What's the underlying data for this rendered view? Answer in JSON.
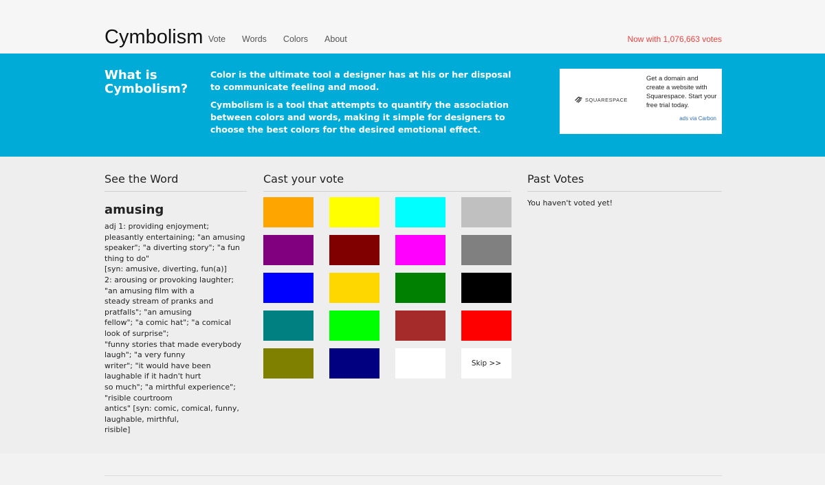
{
  "header": {
    "logo": "Cymbolism",
    "nav": [
      "Vote",
      "Words",
      "Colors",
      "About"
    ],
    "votes_text": "Now with 1,076,663 votes"
  },
  "hero": {
    "title": "What is Cymbolism?",
    "paragraph1": "Color is the ultimate tool a designer has at his or her disposal to communicate feeling and mood.",
    "paragraph2": "Cymbolism is a tool that attempts to quantify the association between colors and words, making it simple for designers to choose the best colors for the desired emotional effect."
  },
  "ad": {
    "brand": "SQUARESPACE",
    "text": "Get a domain and create a website with Squarespace. Start your free trial today.",
    "via": "ads via Carbon"
  },
  "word_section": {
    "heading": "See the Word",
    "word": "amusing",
    "definition": "adj 1: providing enjoyment; pleasantly entertaining; \"an amusing\nspeaker\"; \"a diverting story\"; \"a fun thing to do\"\n[syn: amusive, diverting, fun(a)]\n2: arousing or provoking laughter; \"an amusing film with a\nsteady stream of pranks and pratfalls\"; \"an amusing\nfellow\"; \"a comic hat\"; \"a comical look of surprise\";\n\"funny stories that made everybody laugh\"; \"a very funny\nwriter\"; \"it would have been laughable if it hadn't hurt\nso much\"; \"a mirthful experience\"; \"risible courtroom\nantics\" [syn: comic, comical, funny, laughable, mirthful,\nrisible]"
  },
  "vote_section": {
    "heading": "Cast your vote",
    "colors": [
      {
        "name": "orange",
        "hex": "#ffa500"
      },
      {
        "name": "yellow",
        "hex": "#ffff00"
      },
      {
        "name": "cyan",
        "hex": "#00ffff"
      },
      {
        "name": "silver",
        "hex": "#c0c0c0"
      },
      {
        "name": "purple",
        "hex": "#800080"
      },
      {
        "name": "maroon",
        "hex": "#800000"
      },
      {
        "name": "magenta",
        "hex": "#ff00ff"
      },
      {
        "name": "gray",
        "hex": "#808080"
      },
      {
        "name": "blue",
        "hex": "#0000ff"
      },
      {
        "name": "gold",
        "hex": "#ffd700"
      },
      {
        "name": "green",
        "hex": "#008000"
      },
      {
        "name": "black",
        "hex": "#000000"
      },
      {
        "name": "teal",
        "hex": "#008080"
      },
      {
        "name": "lime",
        "hex": "#00ff00"
      },
      {
        "name": "brown",
        "hex": "#a52a2a"
      },
      {
        "name": "red",
        "hex": "#ff0000"
      },
      {
        "name": "olive",
        "hex": "#808000"
      },
      {
        "name": "navy",
        "hex": "#000080"
      },
      {
        "name": "white",
        "hex": "#ffffff"
      }
    ],
    "skip_label": "Skip >>"
  },
  "past_section": {
    "heading": "Past Votes",
    "empty_text": "You haven't voted yet!"
  }
}
